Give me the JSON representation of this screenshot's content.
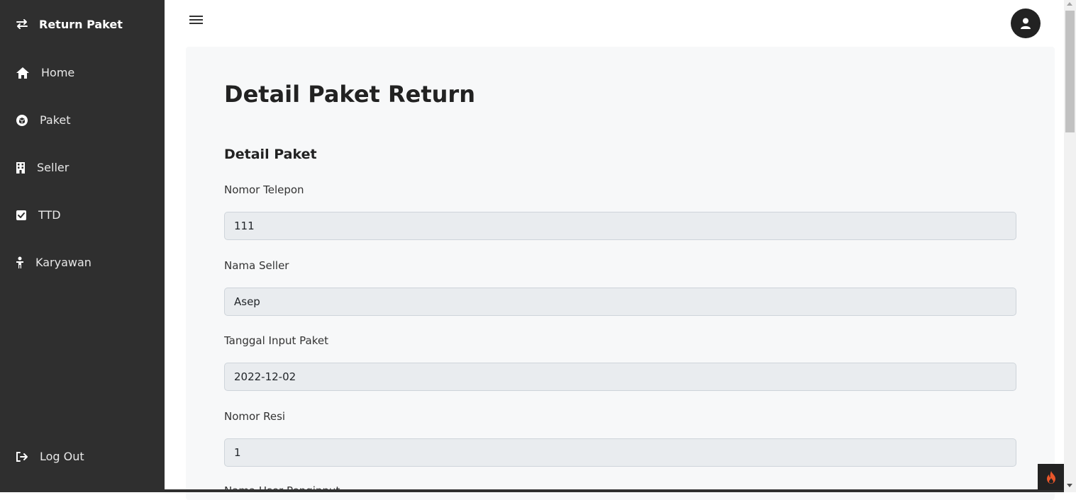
{
  "sidebar": {
    "brand": {
      "label": "Return Paket",
      "icon": "swap-arrows-icon"
    },
    "items": [
      {
        "label": "Home",
        "icon": "home-icon"
      },
      {
        "label": "Paket",
        "icon": "box-icon"
      },
      {
        "label": "Seller",
        "icon": "building-icon"
      },
      {
        "label": "TTD",
        "icon": "checkbox-icon"
      },
      {
        "label": "Karyawan",
        "icon": "person-icon"
      }
    ],
    "logout": {
      "label": "Log Out",
      "icon": "logout-icon"
    }
  },
  "header": {
    "menu_icon": "hamburger-icon",
    "avatar_icon": "user-icon"
  },
  "main": {
    "title": "Detail Paket Return",
    "section_title": "Detail Paket",
    "fields": [
      {
        "label": "Nomor Telepon",
        "value": "111"
      },
      {
        "label": "Nama Seller",
        "value": "Asep"
      },
      {
        "label": "Tanggal Input Paket",
        "value": "2022-12-02"
      },
      {
        "label": "Nomor Resi",
        "value": "1"
      }
    ],
    "cut_off_label": "Nama User Penginput"
  },
  "colors": {
    "sidebar_bg": "#2f2f2f",
    "card_bg": "#f7f8f9",
    "input_bg": "#e9ecef",
    "debug_flame": "#e8562a"
  }
}
